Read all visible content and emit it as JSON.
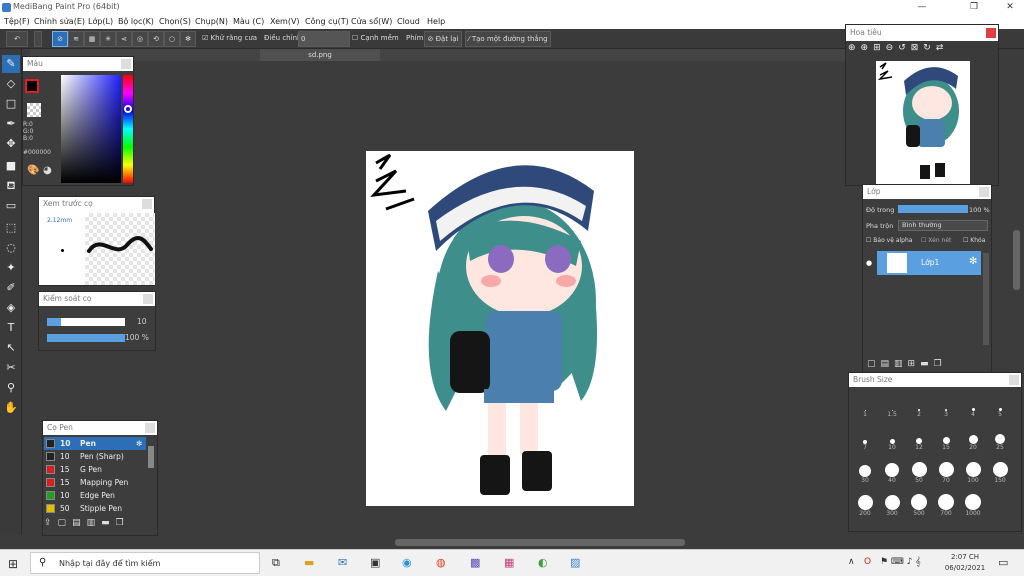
{
  "window": {
    "title": "MediBang Paint Pro (64bit)",
    "min": "—",
    "max": "❐",
    "close": "✕"
  },
  "menu": [
    "Tệp(F)",
    "Chỉnh sửa(E)",
    "Lớp(L)",
    "Bộ lọc(K)",
    "Chọn(S)",
    "Chụp(N)",
    "Màu (C)",
    "Xem(V)",
    "Công cụ(T)",
    "Cửa sổ(W)",
    "Cloud",
    "Help"
  ],
  "toolbar": {
    "antialias": "Khử răng cưa",
    "adjust": "Điều chỉnh",
    "adjust_value": "0",
    "edge": "Cạnh mềm",
    "keys": "Phím",
    "reset": "Đặt lại",
    "new_line": "Tạo một đường thẳng"
  },
  "tab": {
    "name": "sd.png"
  },
  "color_panel": {
    "title": "Màu",
    "r": "R:0",
    "g": "G:0",
    "b": "B:0",
    "hex": "#000000"
  },
  "preview_panel": {
    "title": "Xem trước cọ",
    "size": "2.12mm"
  },
  "control_panel": {
    "title": "Kiểm soát cọ",
    "size_val": "10",
    "opacity_val": "100 %"
  },
  "brush_panel": {
    "title": "Cọ Pen",
    "items": [
      {
        "size": "10",
        "name": "Pen",
        "color": "#222222"
      },
      {
        "size": "10",
        "name": "Pen (Sharp)",
        "color": "#222222"
      },
      {
        "size": "15",
        "name": "G Pen",
        "color": "#d32020"
      },
      {
        "size": "15",
        "name": "Mapping Pen",
        "color": "#d32020"
      },
      {
        "size": "10",
        "name": "Edge Pen",
        "color": "#20a020"
      },
      {
        "size": "50",
        "name": "Stipple Pen",
        "color": "#e0c000"
      }
    ]
  },
  "navigator": {
    "title": "Hoa tiêu"
  },
  "layer_panel": {
    "title": "Lớp",
    "opacity_label": "Độ trong",
    "opacity_val": "100 %",
    "blend_label": "Pha trộn",
    "blend_val": "Bình thường",
    "protect_alpha": "Bảo vệ alpha",
    "clipping": "Xén nét",
    "lock": "Khóa",
    "layer_name": "Lớp1"
  },
  "brush_size_panel": {
    "title": "Brush Size",
    "sizes": [
      "1",
      "1.5",
      "2",
      "3",
      "4",
      "5",
      "7",
      "10",
      "12",
      "15",
      "20",
      "25",
      "30",
      "40",
      "50",
      "70",
      "100",
      "150",
      "200",
      "300",
      "500",
      "700",
      "1000"
    ]
  },
  "taskbar": {
    "search": "Nhập tại đây để tìm kiếm",
    "time": "2:07 CH",
    "date": "06/02/2021"
  }
}
